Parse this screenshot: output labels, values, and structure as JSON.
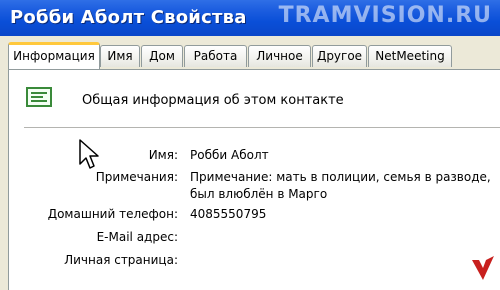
{
  "window": {
    "title": "Робби Аболт Свойства"
  },
  "watermark": "TRAMVISION.RU",
  "tabs": [
    {
      "label": "Информация",
      "active": true
    },
    {
      "label": "Имя"
    },
    {
      "label": "Дом"
    },
    {
      "label": "Работа"
    },
    {
      "label": "Личное"
    },
    {
      "label": "Другое"
    },
    {
      "label": "NetMeeting"
    }
  ],
  "section": {
    "title": "Общая информация об этом контакте",
    "icon": "contact-card-icon"
  },
  "fields": {
    "name": {
      "label": "Имя:",
      "value": "Робби Аболт"
    },
    "notes": {
      "label": "Примечания:",
      "value_line1": "Примечание: мать в полиции, семья в разводе,",
      "value_line2": "был влюблён в Марго"
    },
    "home_phone": {
      "label": "Домашний телефон:",
      "value": "4085550795"
    },
    "email": {
      "label": "E-Mail адрес:",
      "value": ""
    },
    "homepage": {
      "label": "Личная страница:",
      "value": ""
    }
  },
  "colors": {
    "titlebar": "#0a4fd8",
    "active_tab_accent": "#ffc83c",
    "tab_border": "#919b9c"
  }
}
